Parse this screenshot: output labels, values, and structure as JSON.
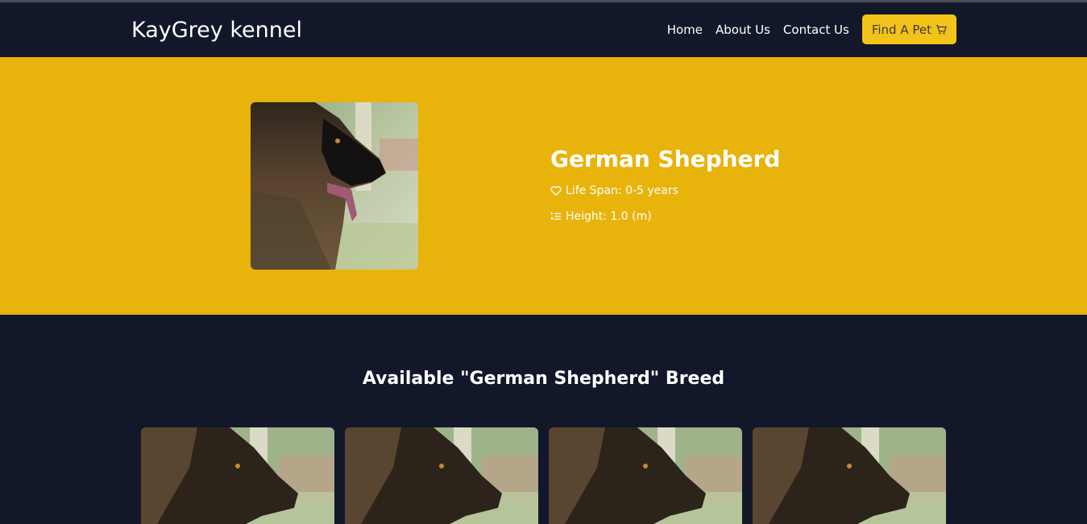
{
  "nav": {
    "brand": "KayGrey kennel",
    "links": [
      "Home",
      "About Us",
      "Contact Us"
    ],
    "cta_label": "Find A Pet",
    "cta_icon": "cart-icon"
  },
  "hero": {
    "breed_name": "German Shepherd",
    "life_span": "Life Span: 0-5 years",
    "height": "Height: 1.0 (m)"
  },
  "available": {
    "heading": "Available \"German Shepherd\" Breed"
  },
  "colors": {
    "navy": "#121829",
    "hero_yellow": "#e8b30b",
    "button_yellow": "#f4c31a"
  }
}
